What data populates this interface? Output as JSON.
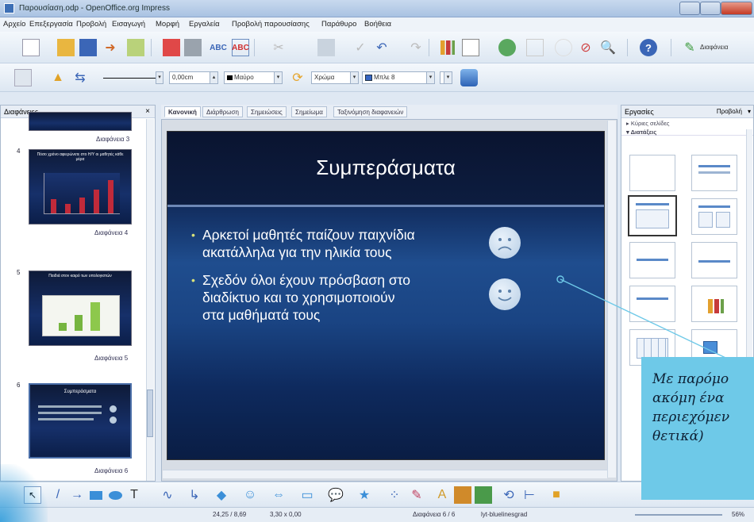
{
  "window": {
    "title": "Παρουσίαση.odp - OpenOffice.org Impress"
  },
  "menu": [
    "Αρχείο",
    "Επεξεργασία",
    "Προβολή",
    "Εισαγωγή",
    "Μορφή",
    "Εργαλεία",
    "Προβολή παρουσίασης",
    "Παράθυρο",
    "Βοήθεια"
  ],
  "toolbar": {
    "design_label": "Διαφάνεια",
    "line_width": "0,00cm",
    "line_color": "Μαύρο",
    "area_fill": "Χρώμα",
    "area_color": "Μπλε 8"
  },
  "slides_panel": {
    "title": "Διαφάνειες",
    "slides": [
      {
        "num": "",
        "label": "Διαφάνεια 3",
        "thumb_title": ""
      },
      {
        "num": "4",
        "label": "Διαφάνεια 4",
        "thumb_title": "Πόσο χρόνο αφιερώνετε στο Η/Υ οι μαθητές κάθε μέρα"
      },
      {
        "num": "5",
        "label": "Διαφάνεια 5",
        "thumb_title": "Παιδιά στον καιρό των υπολογιστών"
      },
      {
        "num": "6",
        "label": "Διαφάνεια 6",
        "thumb_title": "Συμπεράσματα"
      }
    ]
  },
  "view_tabs": [
    "Κανονική",
    "Διάρθρωση",
    "Σημειώσεις",
    "Σημείωμα",
    "Ταξινόμηση διαφανειών"
  ],
  "slide": {
    "title": "Συμπεράσματα",
    "bullets": [
      {
        "lines": [
          "Αρκετοί μαθητές παίζουν παιχνίδια",
          "ακατάλληλα για την ηλικία τους"
        ],
        "face": "sad"
      },
      {
        "lines": [
          "Σχεδόν όλοι έχουν πρόσβαση στο",
          "διαδίκτυο και το χρησιμοποιούν",
          "στα μαθήματά τους"
        ],
        "face": "happy"
      }
    ]
  },
  "tasks_panel": {
    "title": "Εργασίες",
    "view_label": "Προβολή",
    "sections": [
      "Κύριες σελίδες",
      "Διατάξεις"
    ]
  },
  "status": {
    "position": "24,25 / 8,69",
    "size": "3,30 x 0,00",
    "slide": "Διαφάνεια 6 / 6",
    "master": "lyt-bluelinesgrad",
    "zoom": "56%"
  },
  "callout": {
    "lines": [
      "Με παρόμο",
      "ακόμη ένα",
      "περιεχόμεν",
      "θετικά)"
    ]
  },
  "colors": {
    "accent": "#6ec9e8",
    "slide_bg": "#1a4483",
    "bullet": "#d9e27a"
  }
}
